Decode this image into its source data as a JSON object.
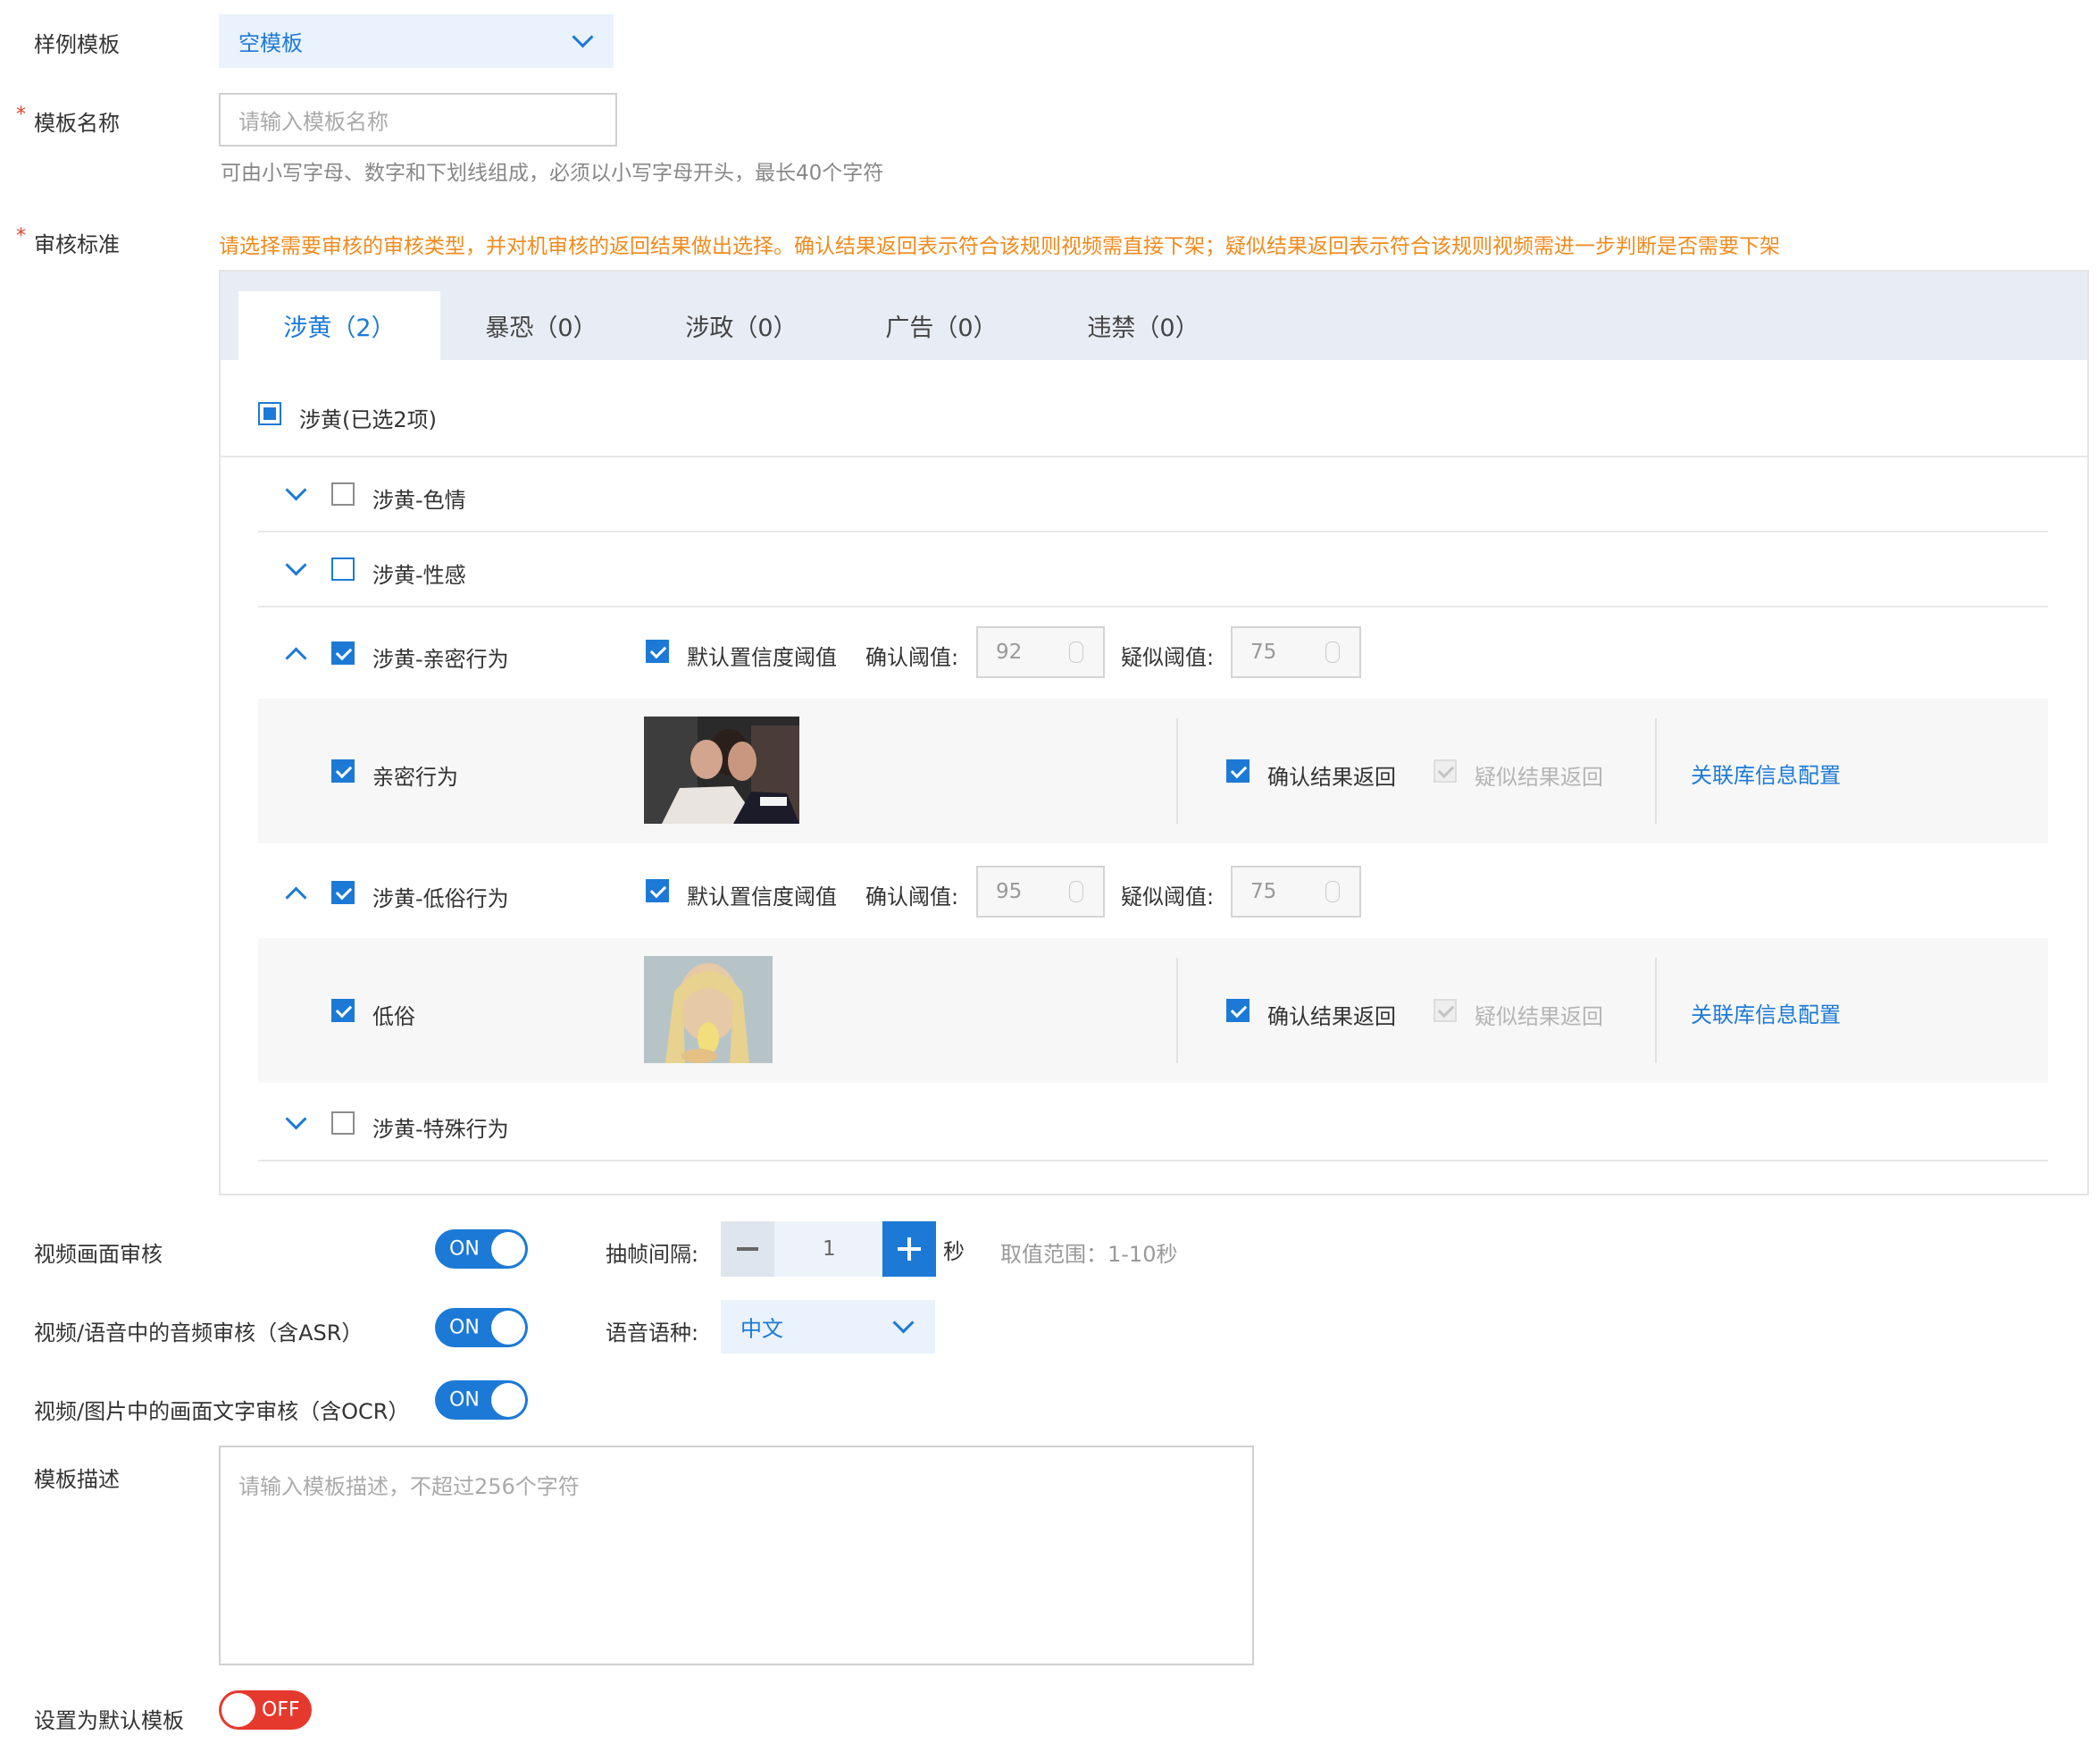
{
  "sample_template": {
    "label": "样例模板",
    "value": "空模板"
  },
  "template_name": {
    "label": "模板名称",
    "placeholder": "请输入模板名称",
    "hint": "可由小写字母、数字和下划线组成，必须以小写字母开头，最长40个字符"
  },
  "review_standard": {
    "label": "审核标准",
    "notice": "请选择需要审核的审核类型，并对机审核的返回结果做出选择。确认结果返回表示符合该规则视频需直接下架；疑似结果返回表示符合该规则视频需进一步判断是否需要下架"
  },
  "tabs": [
    "涉黄（2）",
    "暴恐（0）",
    "涉政（0）",
    "广告（0）",
    "违禁（0）"
  ],
  "group_header": "涉黄(已选2项)",
  "categories": [
    {
      "name": "涉黄-色情"
    },
    {
      "name": "涉黄-性感"
    },
    {
      "name": "涉黄-亲密行为",
      "default_threshold_label": "默认置信度阈值",
      "confirm_label": "确认阈值:",
      "confirm_value": "92",
      "suspect_label": "疑似阈值:",
      "suspect_value": "75",
      "sub": {
        "name": "亲密行为",
        "confirm_return": "确认结果返回",
        "suspect_return": "疑似结果返回",
        "link": "关联库信息配置"
      }
    },
    {
      "name": "涉黄-低俗行为",
      "default_threshold_label": "默认置信度阈值",
      "confirm_label": "确认阈值:",
      "confirm_value": "95",
      "suspect_label": "疑似阈值:",
      "suspect_value": "75",
      "sub": {
        "name": "低俗",
        "confirm_return": "确认结果返回",
        "suspect_return": "疑似结果返回",
        "link": "关联库信息配置"
      }
    },
    {
      "name": "涉黄-特殊行为"
    }
  ],
  "video_frame": {
    "label": "视频画面审核",
    "toggle": "ON",
    "interval_label": "抽帧间隔:",
    "interval_value": "1",
    "unit": "秒",
    "range_hint": "取值范围：1-10秒"
  },
  "audio": {
    "label": "视频/语音中的音频审核（含ASR）",
    "toggle": "ON",
    "lang_label": "语音语种:",
    "lang_value": "中文"
  },
  "ocr": {
    "label": "视频/图片中的画面文字审核（含OCR）",
    "toggle": "ON"
  },
  "description": {
    "label": "模板描述",
    "placeholder": "请输入模板描述，不超过256个字符"
  },
  "default_template": {
    "label": "设置为默认模板",
    "toggle": "OFF"
  },
  "colors": {
    "primary": "#1c7ad6",
    "warning": "#f08a1c",
    "required": "#e0412b",
    "off": "#e5392d"
  }
}
